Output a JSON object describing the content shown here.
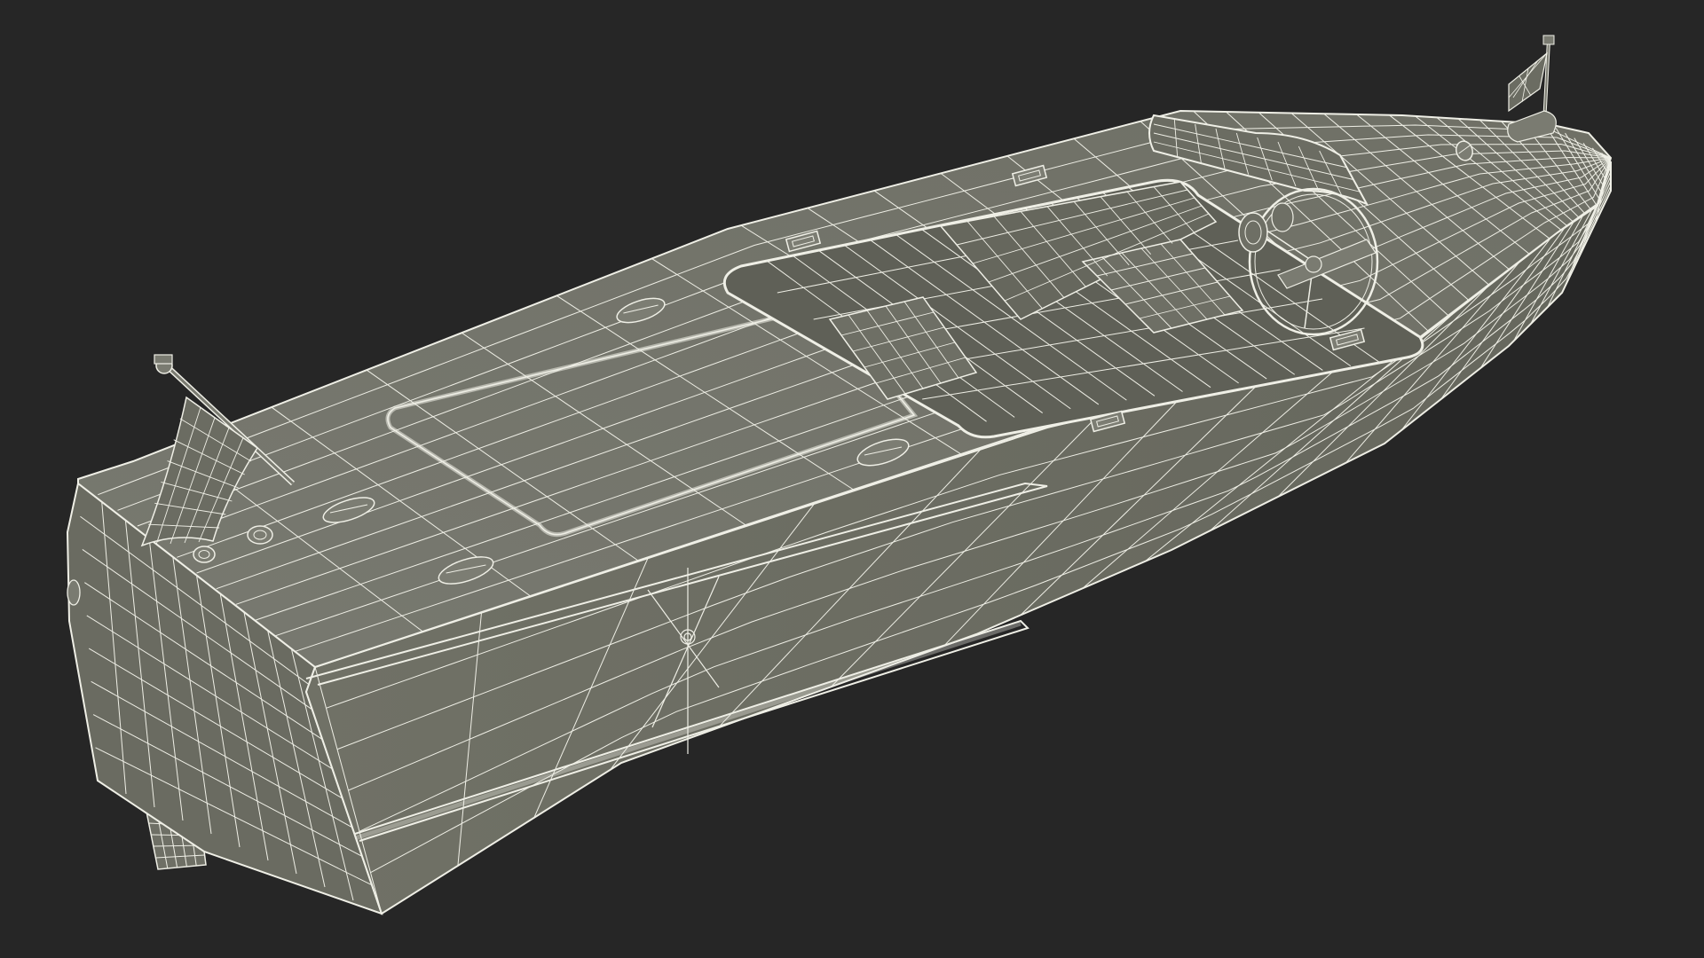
{
  "scene": {
    "background_color": "#262626",
    "mesh_fill_color": "#75766b",
    "mesh_fill_shadow": "#5f6057",
    "mesh_fill_light": "#84857a",
    "wire_color": "#efefe6",
    "subject": "wireframe-speedboat"
  }
}
